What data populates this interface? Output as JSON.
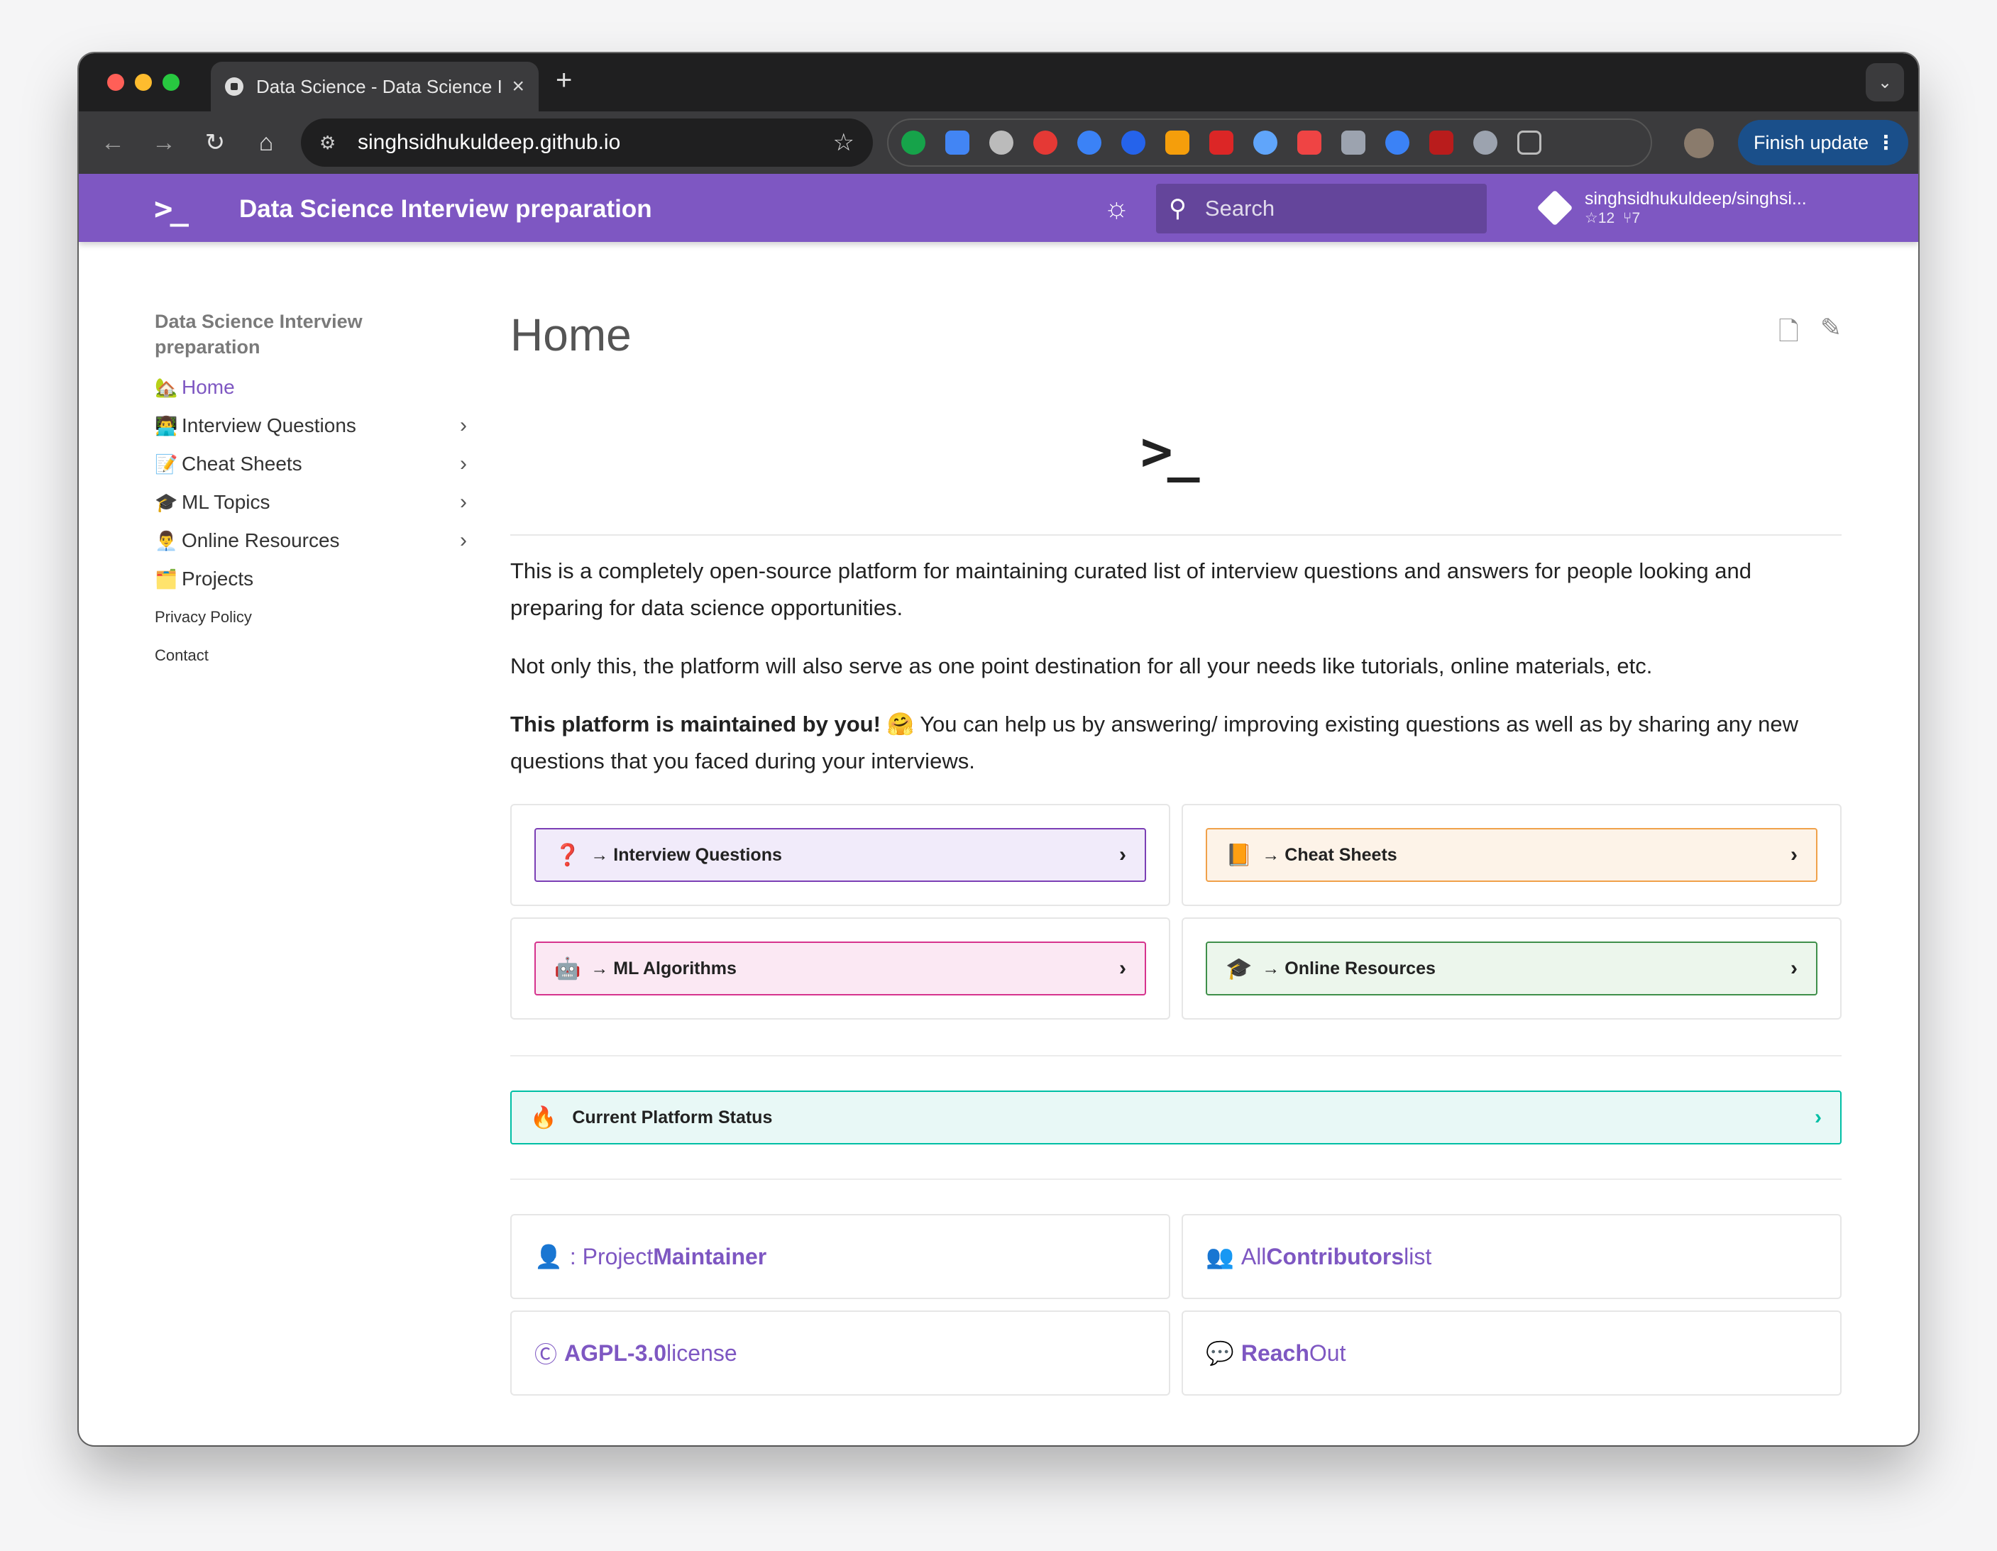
{
  "browser": {
    "tab_title": "Data Science - Data Science I",
    "url": "singhsidhukuldeep.github.io",
    "finish_update": "Finish update"
  },
  "header": {
    "logo": ">_",
    "title": "Data Science Interview preparation",
    "search_placeholder": "Search",
    "repo_name": "singhsidhukuldeep/singhsi...",
    "repo_stars": "☆12",
    "repo_forks": "⑂7"
  },
  "sidebar": {
    "title": "Data Science Interview preparation",
    "items": [
      {
        "emoji": "🏡",
        "label": "Home"
      },
      {
        "emoji": "👨‍💻",
        "label": "Interview Questions"
      },
      {
        "emoji": "📝",
        "label": "Cheat Sheets"
      },
      {
        "emoji": "🎓",
        "label": "ML Topics"
      },
      {
        "emoji": "👨‍💼",
        "label": "Online Resources"
      },
      {
        "emoji": "🗂️",
        "label": "Projects"
      }
    ],
    "small": [
      "Privacy Policy",
      "Contact"
    ]
  },
  "main": {
    "title": "Home",
    "hero": ">_",
    "p1": "This is a completely open-source platform for maintaining curated list of interview questions and answers for people looking and preparing for data science opportunities.",
    "p2": "Not only this, the platform will also serve as one point destination for all your needs like tutorials, online materials, etc.",
    "p3_bold": "This platform is maintained by you!",
    "p3_emoji": "🤗",
    "p3_rest": " You can help us by answering/ improving existing questions as well as by sharing any new questions that you faced during your interviews.",
    "links": [
      {
        "label": "→ Interview Questions"
      },
      {
        "label": "→ Cheat Sheets"
      },
      {
        "label": "→ ML Algorithms"
      },
      {
        "label": "→ Online Resources"
      }
    ],
    "status": "Current Platform Status",
    "cards": {
      "maintainer_pre": ": Project ",
      "maintainer_bold": "Maintainer",
      "contrib_pre": "All ",
      "contrib_bold": "Contributors",
      "contrib_post": " list",
      "license_bold": "AGPL-3.0",
      "license_post": " license",
      "reach_bold": "Reach",
      "reach_post": " Out"
    }
  },
  "colors": {
    "accent": "#7e57c2",
    "teal": "#00bfa5"
  }
}
